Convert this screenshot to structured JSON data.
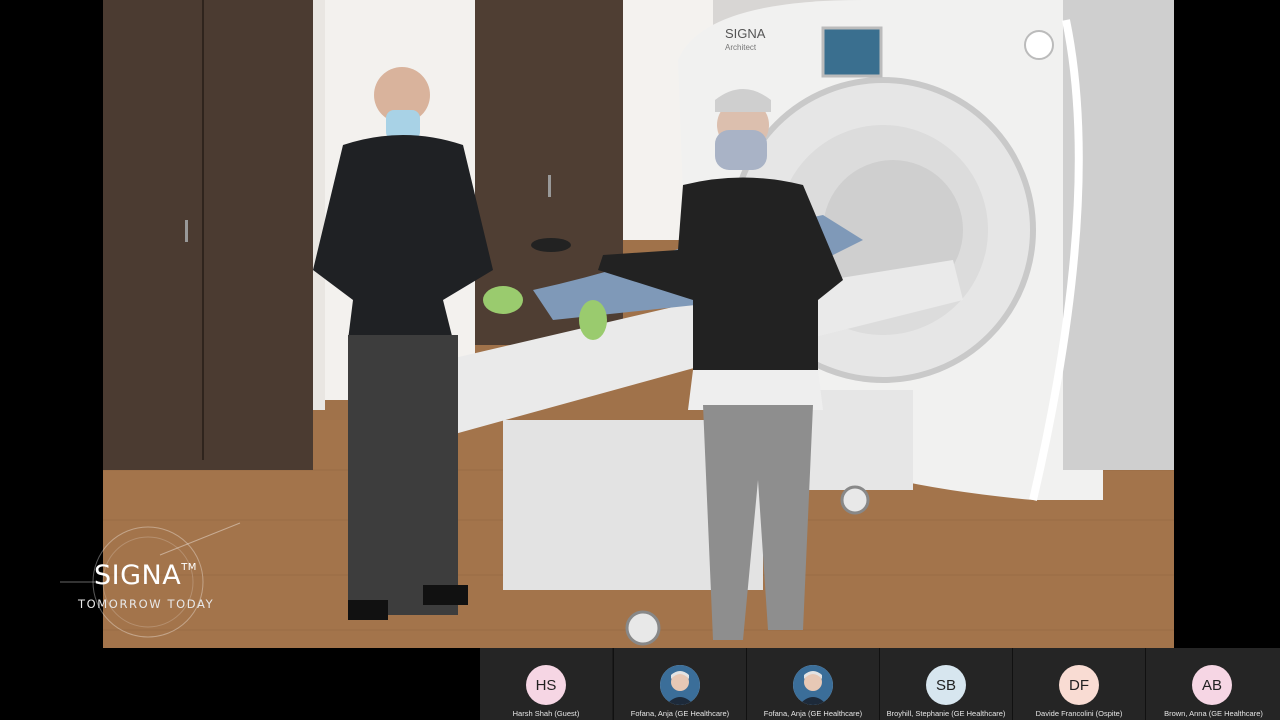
{
  "video": {
    "scanner_brand": "SIGNA",
    "scanner_model": "Architect"
  },
  "watermark": {
    "title": "SIGNA",
    "trademark": "TM",
    "tagline": "TOMORROW TODAY"
  },
  "participants": [
    {
      "initials": "HS",
      "name": "Harsh Shah (Guest)",
      "avatar_color": "#f6d6e4",
      "photo": false
    },
    {
      "initials": "",
      "name": "Fofana, Anja (GE Healthcare)",
      "avatar_color": "#c9d6e2",
      "photo": true
    },
    {
      "initials": "",
      "name": "Fofana, Anja (GE Healthcare)",
      "avatar_color": "#c9d6e2",
      "photo": true
    },
    {
      "initials": "SB",
      "name": "Broyhill, Stephanie (GE Healthcare)",
      "avatar_color": "#d7e6ef",
      "photo": false
    },
    {
      "initials": "DF",
      "name": "Davide Francolini (Ospite)",
      "avatar_color": "#f9dcd3",
      "photo": false
    },
    {
      "initials": "AB",
      "name": "Brown, Anna (GE Healthcare)",
      "avatar_color": "#f6d6e4",
      "photo": false
    }
  ]
}
